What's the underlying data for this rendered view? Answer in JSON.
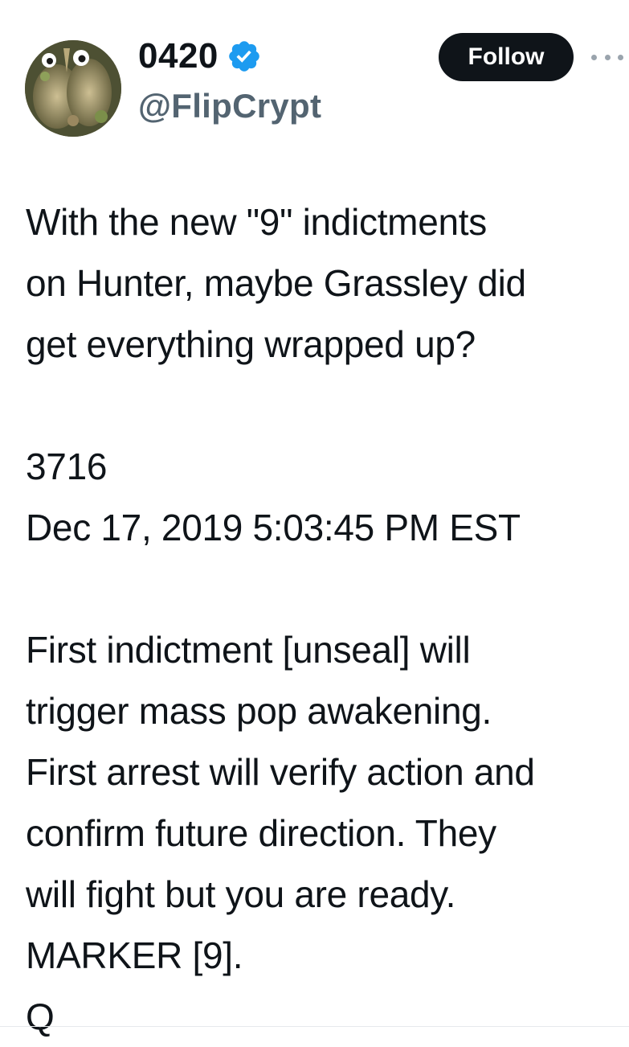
{
  "author": {
    "display_name": "0420",
    "handle": "@FlipCrypt",
    "verified_icon": "verified-badge-icon",
    "avatar_icon": "avatar-image"
  },
  "actions": {
    "follow_label": "Follow",
    "more_icon": "more-options-icon"
  },
  "tweet": {
    "lines": [
      "With the new \"9\" indictments",
      "on Hunter, maybe Grassley did",
      "get everything wrapped up?",
      "",
      "3716",
      "Dec 17, 2019 5:03:45 PM EST",
      "",
      "First indictment [unseal] will",
      "trigger mass pop awakening.",
      "First arrest will verify action and",
      "confirm future direction. They",
      "will fight but you are ready.",
      "MARKER [9].",
      "Q"
    ]
  },
  "colors": {
    "text": "#0f1419",
    "secondary": "#536471",
    "verified_blue": "#1d9bf0",
    "button_bg": "#0f1419"
  }
}
